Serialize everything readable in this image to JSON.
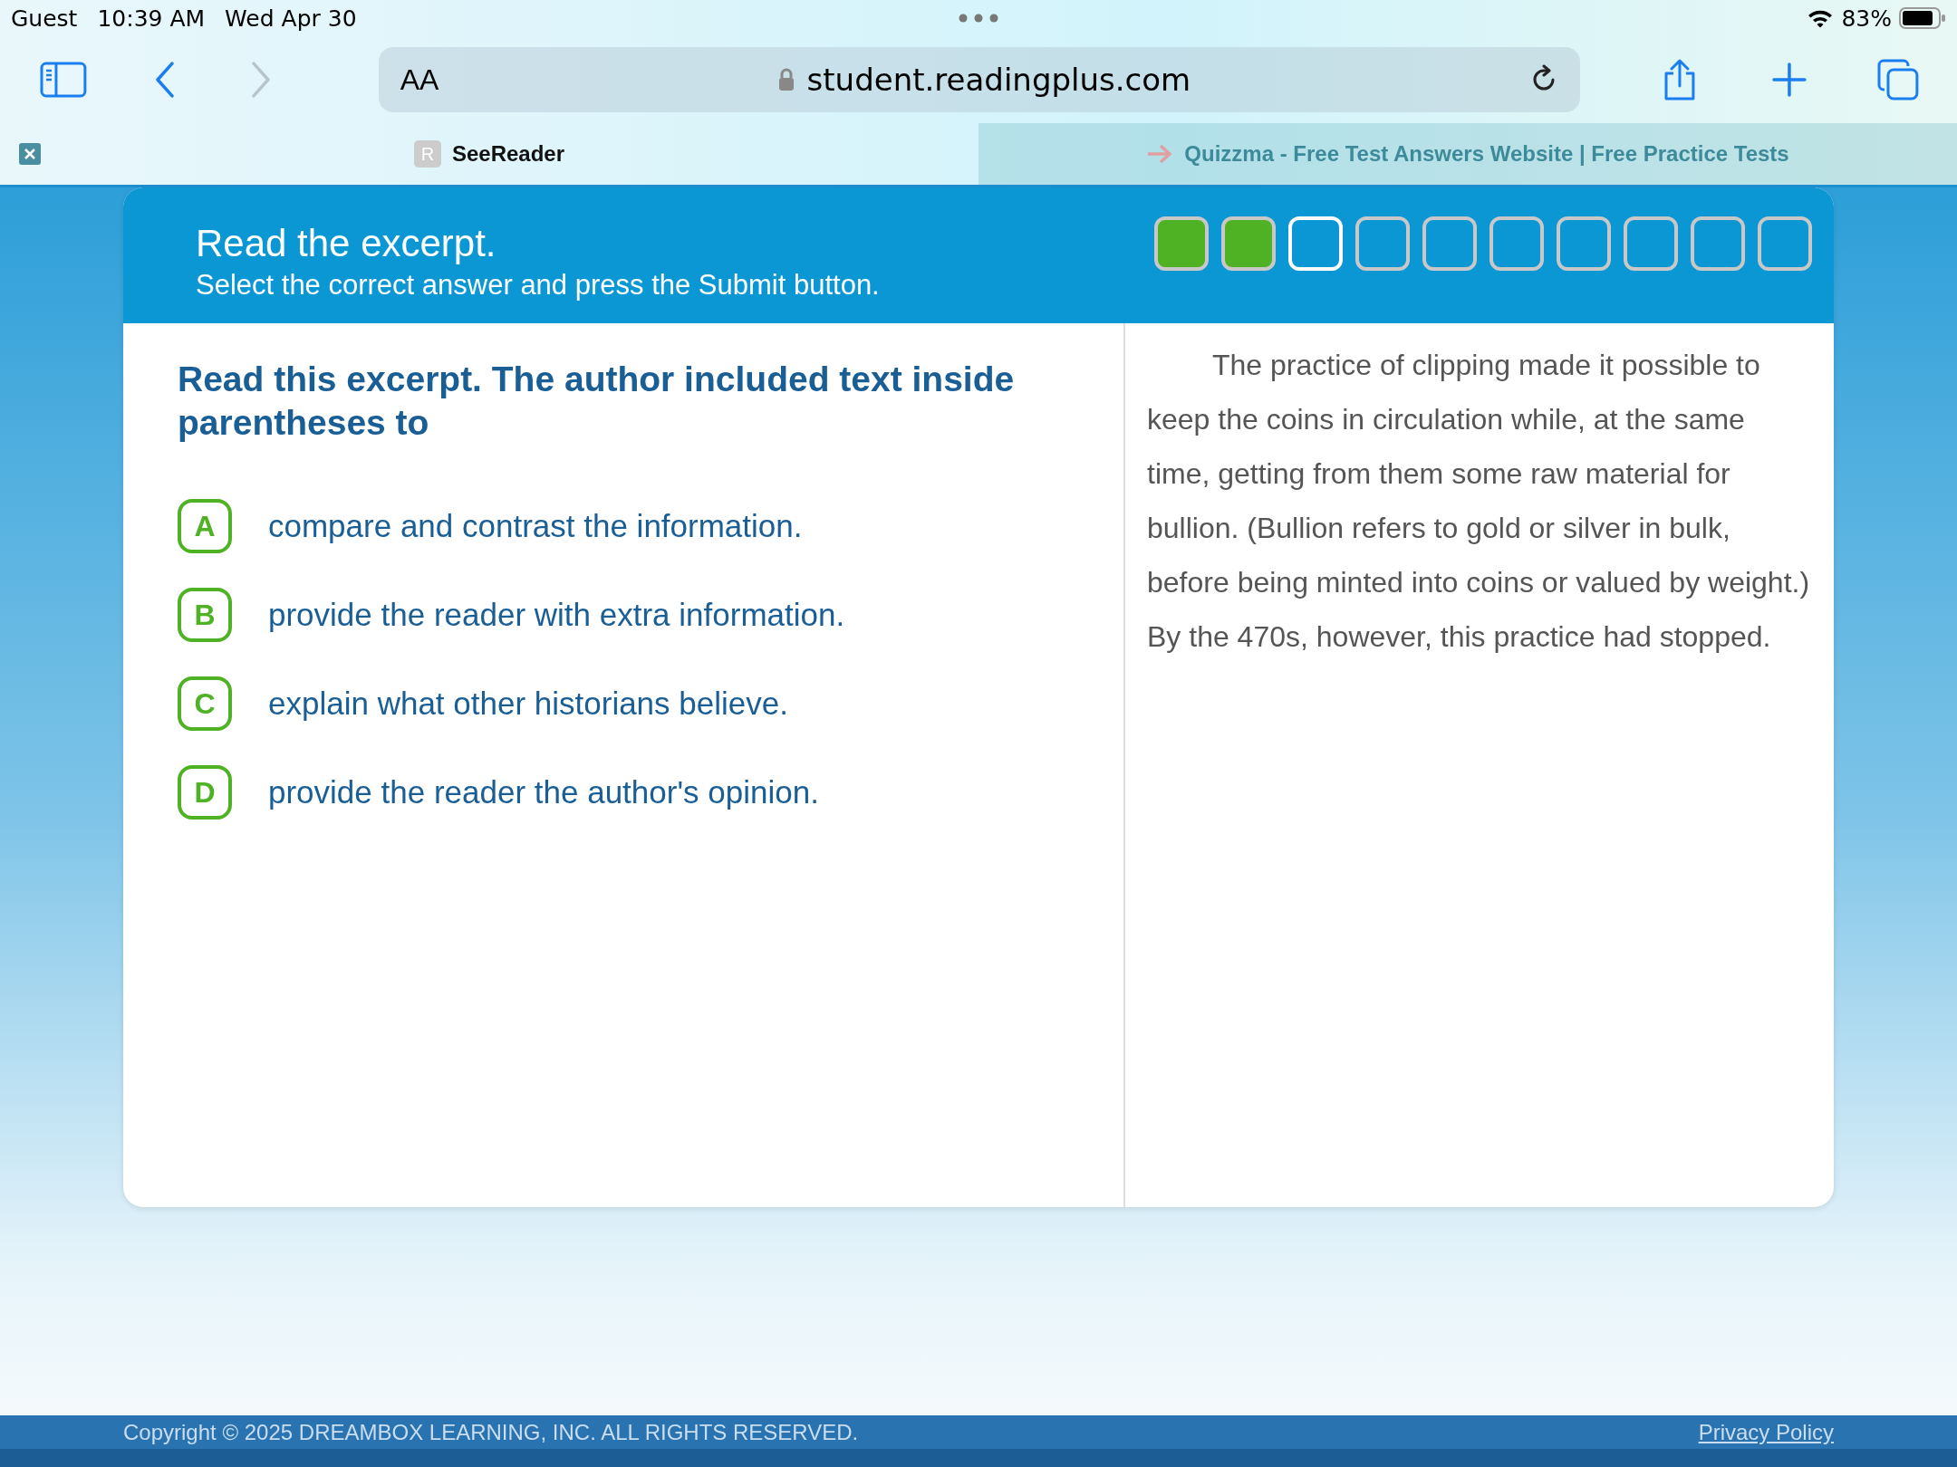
{
  "status_bar": {
    "user": "Guest",
    "time": "10:39 AM",
    "date": "Wed Apr 30",
    "battery": "83%"
  },
  "browser": {
    "text_size": "AA",
    "url": "student.readingplus.com"
  },
  "tabs": [
    {
      "label": "SeeReader",
      "favicon": "R",
      "selected": true
    },
    {
      "label": "Quizzma - Free Test Answers Website | Free Practice Tests",
      "selected": false
    }
  ],
  "header": {
    "title": "Read the excerpt.",
    "instruction": "Select the correct answer and press the Submit button.",
    "progress": [
      {
        "kind": "complete"
      },
      {
        "kind": "complete"
      },
      {
        "kind": "current"
      },
      {
        "kind": "pending"
      },
      {
        "kind": "pending"
      },
      {
        "kind": "pending"
      },
      {
        "kind": "pending"
      },
      {
        "kind": "pending"
      },
      {
        "kind": "pending"
      },
      {
        "kind": "pending"
      }
    ]
  },
  "question": "Read this excerpt. The author included text inside parentheses to",
  "options": [
    {
      "letter": "A",
      "text": "compare and contrast the information.",
      "selected": false
    },
    {
      "letter": "B",
      "text": "provide the reader with extra information.",
      "selected": false
    },
    {
      "letter": "C",
      "text": "explain what other historians believe.",
      "selected": false
    },
    {
      "letter": "D",
      "text": "provide the reader the author's opinion.",
      "selected": false
    }
  ],
  "passage": "The practice of clipping made it possible to keep the coins in circulation while, at the same time, getting from them some raw material for bullion. (Bullion refers to gold or silver in bulk, before being minted into coins or valued by weight.) By the 470s, however, this practice had stopped.",
  "footer": {
    "copyright": "Copyright © 2025 DREAMBOX LEARNING, INC. ALL RIGHTS RESERVED.",
    "link": "Privacy Policy"
  }
}
